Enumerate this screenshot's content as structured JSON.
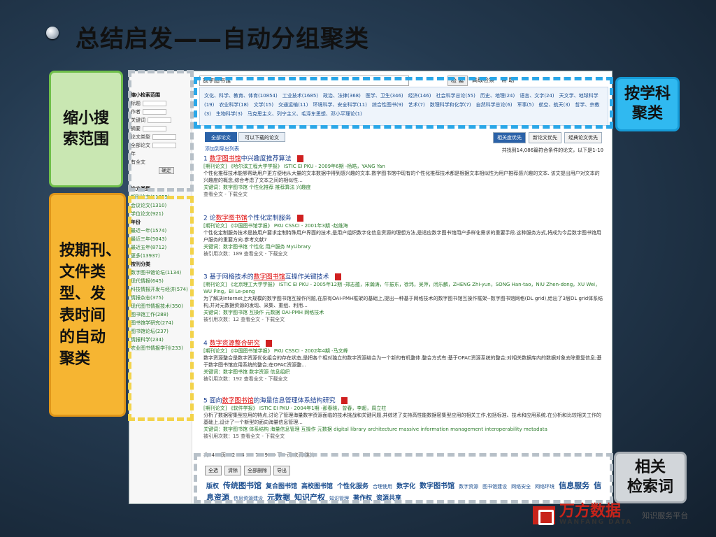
{
  "slide": {
    "title": "总结启发——自动分组聚类"
  },
  "callouts": {
    "narrow": [
      "缩小搜",
      "索范围"
    ],
    "facet": [
      "按期刊、",
      "文件类",
      "型、发",
      "表时间",
      "的自动",
      "聚类"
    ],
    "subject": [
      "按学科",
      "聚类"
    ],
    "related": [
      "相关",
      "检索词"
    ]
  },
  "screenshot": {
    "topbar": {
      "field": "数字图书馆",
      "buttons": [
        "检 索",
        "高级检索",
        "帮 助"
      ]
    },
    "left": {
      "narrow_title": "缩小检索范围",
      "fields": [
        "标题",
        "作者",
        "关键词",
        "摘要",
        "论文类型",
        "全部论文"
      ],
      "year_label": "年",
      "has_full": "有全文",
      "narrow_btn": "确定",
      "type_head": "论文类型",
      "types": [
        "期刊论文(11855)",
        "会议论文(1310)",
        "学位论文(921)"
      ],
      "year_head": "年份",
      "years": [
        "最近一年(1574)",
        "最近三年(5043)",
        "最近五年(8712)",
        "更多(13937)"
      ],
      "cat_head": "按刊分类",
      "cats": [
        "数字图书馆论坛(1134)",
        "现代情报(645)",
        "科技情报开发与经济(574)",
        "情报杂志(375)",
        "现代图书情报技术(350)",
        "图书馆工作(288)",
        "图书馆学研究(274)",
        "图书馆论坛(237)",
        "情报科学(234)",
        "农业图书情报学刊(233)"
      ]
    },
    "subjects": [
      "文化、科学、教育、体育(10854)",
      "工业技术(1685)",
      "政治、法律(368)",
      "医学、卫生(346)",
      "经济(146)",
      "社会科学总论(55)",
      "历史、地理(24)",
      "语言、文字(24)",
      "天文学、地球科学(19)",
      "农业科学(18)",
      "文学(15)",
      "交通运输(11)",
      "环境科学、安全科学(11)",
      "综合性图书(9)",
      "艺术(7)",
      "数理科学和化学(7)",
      "自然科学总论(6)",
      "军事(5)",
      "航空、航天(3)",
      "哲学、宗教(3)",
      "生物科学(3)",
      "马克思主义、列宁主义、毛泽东思想、邓小平理论(1)"
    ],
    "tabs": [
      "全部论文",
      "可以下载的论文"
    ],
    "sort": [
      "相关度优先",
      "新论文优先",
      "经典论文优先"
    ],
    "add_export": "添加到导出列表",
    "count": "共找到14,086篇符合条件的论文，以下是1-10",
    "results": [
      {
        "num": "1",
        "title_pre": "",
        "title_hl": "数字图书馆",
        "title_post": "中兴趣度推荐算法",
        "src": "[期刊论文] 《哈尔滨工程大学学报》 ISTIC EI PKU - 2009年6期 -杨皓，YANG Yan",
        "abs": "个性化推荐技术能够帮助用户更方便地从大量的文本数据中得到感兴趣的文本.数字图书馆中现有的个性化推荐技术都是根据文本相似性为用户推荐感兴趣的文本. 该文提出用户对文本的兴趣度的概念,综合考虑了文本之间的相似性...",
        "kw": "关键词：数字图书馆 个性化推荐 推荐算法 兴趣度",
        "links": "查看全文 - 下载全文"
      },
      {
        "num": "2",
        "title_pre": "论",
        "title_hl": "数字图书馆",
        "title_post": "个性化定制服务",
        "src": "[期刊论文] 《中国图书馆学报》 PKU CSSCI - 2001年3期 -赵维海",
        "abs": "个性化定制服务技术是按用户要求定制特殊用户界面的技术,是用户组织数字化信息资源的理想方法,是适应数字图书馆用户多样化需求的重要手段.这种服务方式,将成为今后数字图书馆用户服务的重要方向.参考文献7",
        "kw": "关键词：数字图书馆 个性化 用户服务 MyLibrary",
        "links": "被引用次数：189 查看全文 - 下载全文"
      },
      {
        "num": "3",
        "title_pre": "基于网格技术的",
        "title_hl": "数字图书馆",
        "title_post": "互操作关键技术",
        "src": "[期刊论文] 《北京理工大学学报》 ISTIC EI PKU - 2005年12期 -郑志蕴，宋瀚涛，牛振东，徐玮，吴萍，闭乐麟，ZHENG Zhi-yun，SONG Han-tao，NIU Zhen-dong，XU Wei，WU Ping，BI Le-peng",
        "abs": "为了解决Internet上大规模的数字图书馆互操作问题,在原有OAI-PMH框架的基础上,提出一种基于网格技术的数字图书馆互操作框架--数字图书馆网格(DL grid),给出了3层DL grid体系结构,并对元数据资源的发现、采集、重组、利用...",
        "kw": "关键词：数字图书馆 互操作 元数据 OAI-PMH 网格技术",
        "links": "被引用次数：12 查看全文 - 下载全文"
      },
      {
        "num": "4",
        "title_pre": "",
        "title_hl": "数字资源整合研究",
        "title_post": "",
        "src": "[期刊论文] 《中国图书馆学报》 PKU CSSCI - 2002年4期 -马文峰",
        "abs": "数字资源整合是数字资源优化组合的存在状态,是把各个相对独立的数字资源结合为一个新的有机整体.整合方式有:基于OPAC资源系统的整合;对相关数据库内的数据对象去除重复信息;基于数字图书馆应用系统的整合;在OPAC资源整...",
        "kw": "关键词：数字图书馆 数字资源 信息组织",
        "links": "被引用次数：192 查看全文 - 下载全文"
      },
      {
        "num": "5",
        "title_pre": "面向",
        "title_hl": "数字图书馆",
        "title_post": "的海量信息管理体系结构研究",
        "src": "[期刊论文] 《软件学报》 ISTIC EI PKU - 2004年1期 -那春晓，曾春，李超，周立柱",
        "abs": "分析了数据密集型应用的特点,讨论了管理海量数字资源面临的技术挑战和关键问题,并综述了支持高性能数据密集型应用的相关工作,包括标准、技术和应用系统.在分析和比较相关工作的基础上,设计了一个新型的面向海量信息管理...",
        "kw": "关键词：数字图书馆 体系结构 海量信息管理 互操作 元数据 digital library architecture massive information management interoperability metadata",
        "links": "被引用次数：15 查看全文 - 下载全文"
      }
    ],
    "pager": "共1409页 1 2 3 4 5 6 7 8 9 10 下一页 末页 跳转",
    "bottom_btns": [
      "全选",
      "清除",
      "全部删除",
      "导出"
    ],
    "related_terms": [
      "版权",
      "传统图书馆",
      "复合图书馆",
      "高校图书馆",
      "个性化服务",
      "合理使用",
      "数字化",
      "数字图书馆",
      "数字资源",
      "图书馆建设",
      "网络安全",
      "网络环境",
      "信息服务",
      "信息资源",
      "信息资源建设",
      "元数据",
      "知识产权",
      "知识管理",
      "著作权",
      "资源共享"
    ]
  },
  "logo": {
    "cn": "万方数据",
    "en": "WANFANG DATA",
    "tag": "知识服务平台"
  },
  "colors": {
    "accent_blue": "#2aa7e8",
    "accent_yellow": "#f3d34a",
    "highlight_red": "#d00000"
  }
}
